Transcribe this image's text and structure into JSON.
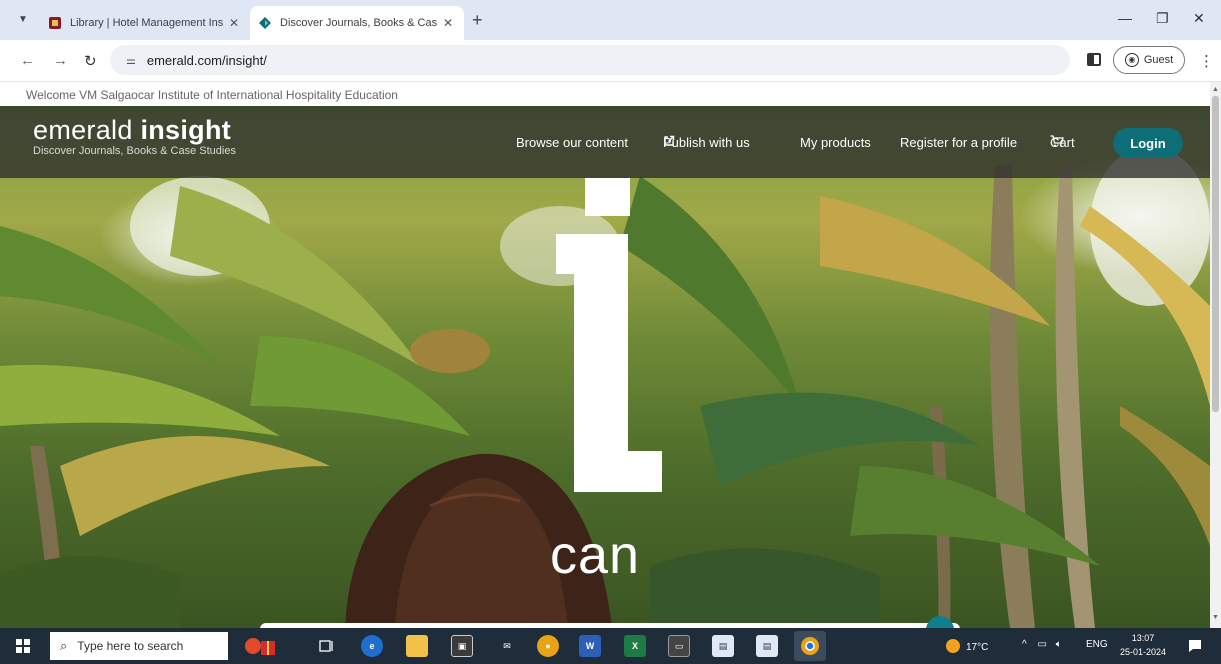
{
  "browser": {
    "tabs": [
      {
        "title": "Library | Hotel Management Ins",
        "active": false
      },
      {
        "title": "Discover Journals, Books & Cas",
        "active": true
      }
    ],
    "new_tab_label": "+",
    "address": "emerald.com/insight/",
    "profile_label": "Guest"
  },
  "page": {
    "welcome_text": "Welcome VM Salgaocar Institute of International Hospitality Education",
    "logo": {
      "part1": "emerald ",
      "part2": "insight",
      "tagline": "Discover Journals, Books & Case Studies"
    },
    "nav": {
      "browse": "Browse our content",
      "publish": "Publish with us",
      "products": "My products",
      "register": "Register for a profile",
      "cart": "Cart",
      "login": "Login"
    },
    "hero_word": "can",
    "accent_color": "#0e6e78"
  },
  "taskbar": {
    "search_placeholder": "Type here to search",
    "weather": "17°C",
    "language": "ENG",
    "time": "13:07",
    "date": "25-01-2024"
  }
}
